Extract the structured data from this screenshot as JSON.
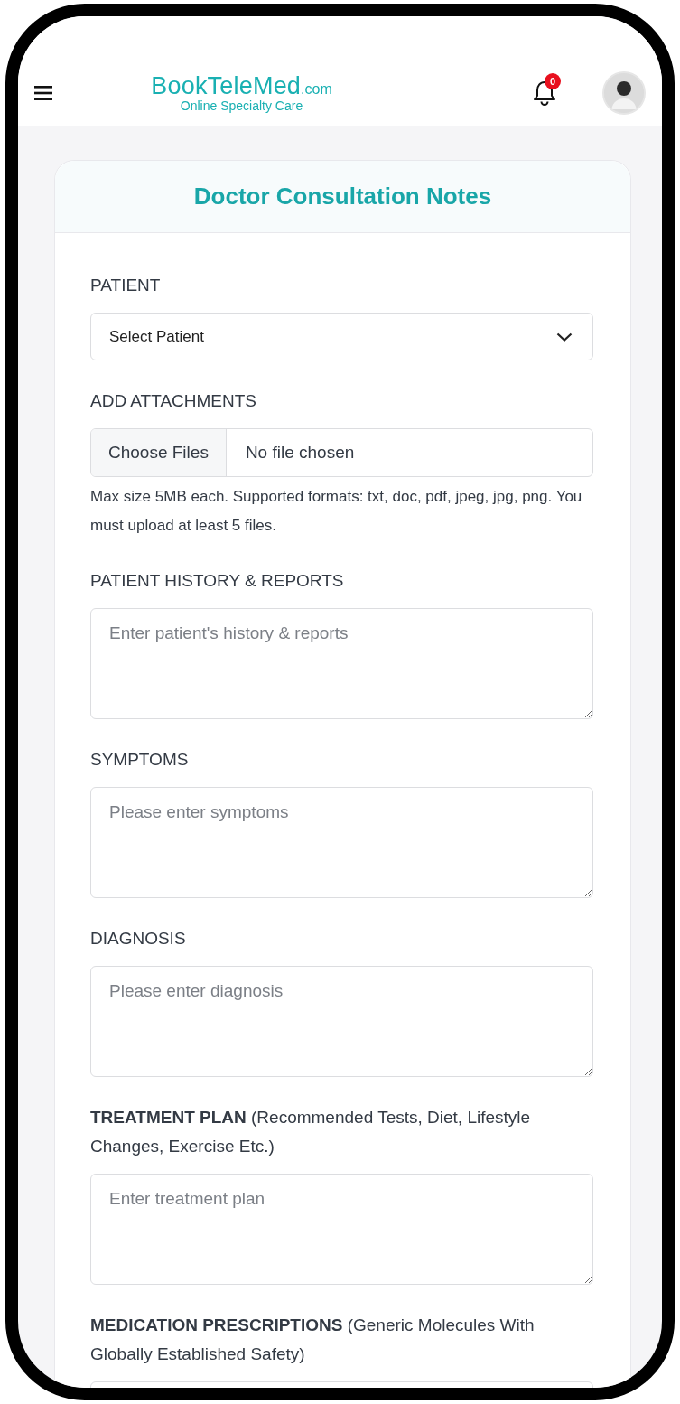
{
  "header": {
    "brand": "BookTeleMed",
    "brand_suffix": ".com",
    "tagline": "Online Specialty Care",
    "notification_count": "0"
  },
  "form": {
    "title": "Doctor Consultation Notes",
    "fields": [
      {
        "kind": "select",
        "label": "PATIENT",
        "value": "Select Patient"
      },
      {
        "kind": "file",
        "label": "ADD ATTACHMENTS",
        "button": "Choose Files",
        "status": "No file chosen",
        "hint": "Max size 5MB each. Supported formats: txt, doc, pdf, jpeg, jpg, png. You must upload at least 5 files."
      },
      {
        "kind": "textarea",
        "label": "PATIENT HISTORY & REPORTS",
        "placeholder": "Enter patient's history & reports"
      },
      {
        "kind": "textarea",
        "label": "SYMPTOMS",
        "placeholder": "Please enter symptoms"
      },
      {
        "kind": "textarea",
        "label": "DIAGNOSIS",
        "placeholder": "Please enter diagnosis"
      },
      {
        "kind": "textarea",
        "label": "**TREATMENT PLAN** (Recommended Tests, Diet, Lifestyle Changes, Exercise Etc.)",
        "placeholder": "Enter treatment plan"
      },
      {
        "kind": "textarea",
        "label": "**MEDICATION PRESCRIPTIONS** (Generic Molecules With Globally Established Safety)"
      }
    ]
  }
}
